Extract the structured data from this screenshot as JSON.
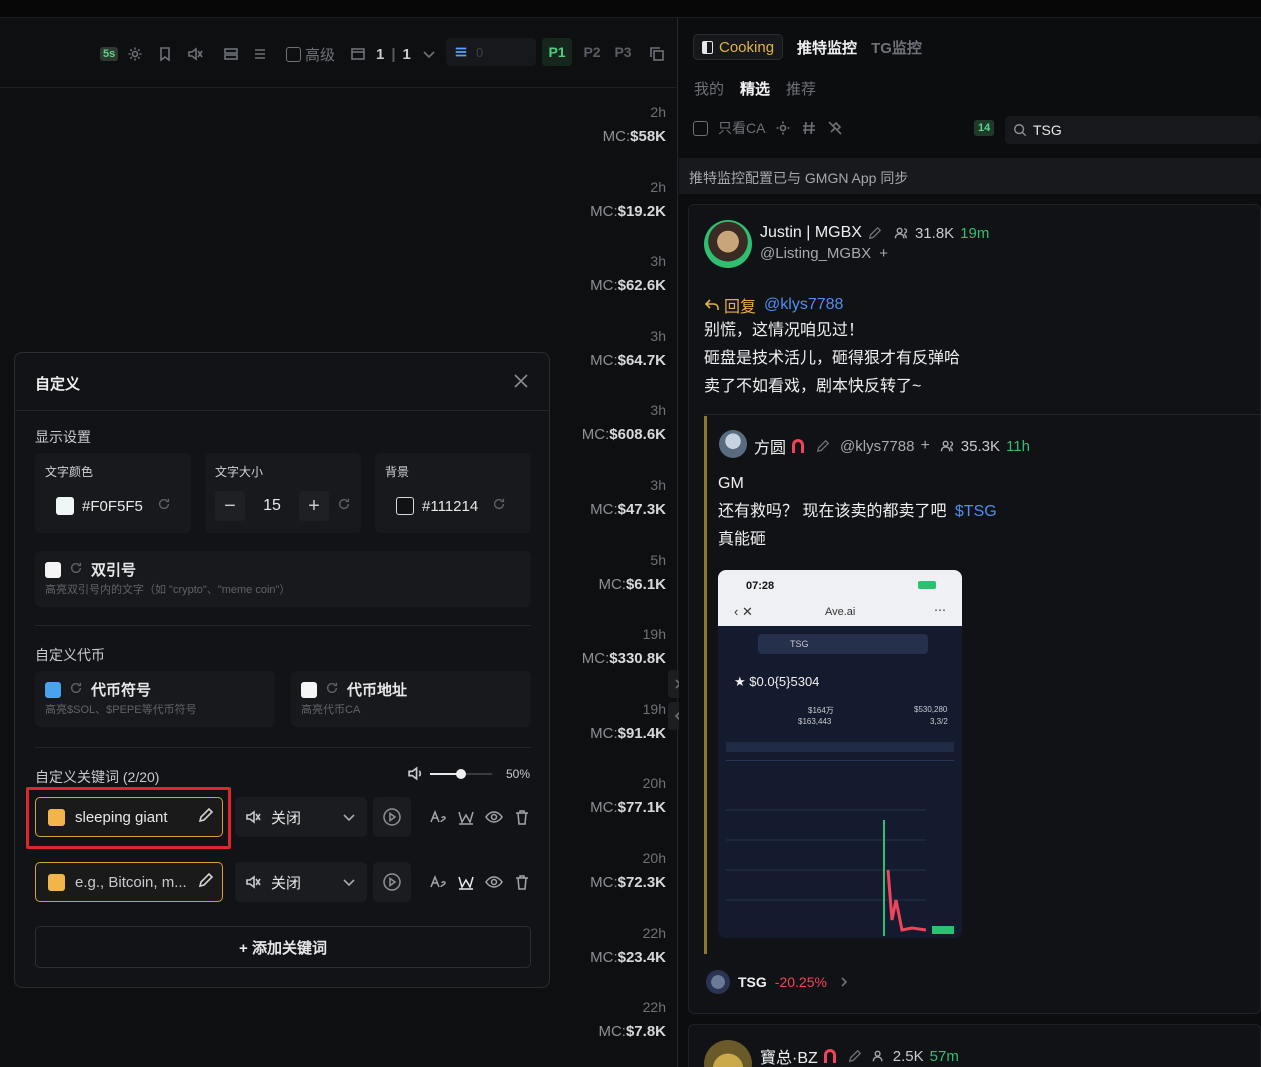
{
  "colors": {
    "accent_gold": "#e3b341",
    "link_blue": "#4d8ff0",
    "green": "#2fbf71",
    "red": "#f0445b",
    "highlight_red": "#e0262b"
  },
  "toolbar": {
    "badge_label": "5s",
    "checkbox_label": "高级",
    "page_counter_a": "1",
    "page_counter_b": "1",
    "input_placeholder": "0",
    "page_buttons": [
      "P1",
      "P2",
      "P3"
    ]
  },
  "feed_rows": [
    {
      "time": "2h",
      "mc_prefix": "MC:",
      "mc": "$58K"
    },
    {
      "time": "2h",
      "mc_prefix": "MC:",
      "mc": "$19.2K"
    },
    {
      "time": "3h",
      "mc_prefix": "MC:",
      "mc": "$62.6K"
    },
    {
      "time": "3h",
      "mc_prefix": "MC:",
      "mc": "$64.7K"
    },
    {
      "time": "3h",
      "mc_prefix": "MC:",
      "mc": "$608.6K"
    },
    {
      "time": "3h",
      "mc_prefix": "MC:",
      "mc": "$47.3K"
    },
    {
      "time": "5h",
      "mc_prefix": "MC:",
      "mc": "$6.1K"
    },
    {
      "time": "19h",
      "mc_prefix": "MC:",
      "mc": "$330.8K"
    },
    {
      "time": "19h",
      "mc_prefix": "MC:",
      "mc": "$91.4K"
    },
    {
      "time": "20h",
      "mc_prefix": "MC:",
      "mc": "$77.1K"
    },
    {
      "time": "20h",
      "mc_prefix": "MC:",
      "mc": "$72.3K"
    },
    {
      "time": "22h",
      "mc_prefix": "MC:",
      "mc": "$23.4K"
    },
    {
      "time": "22h",
      "mc_prefix": "MC:",
      "mc": "$7.8K"
    }
  ],
  "modal": {
    "title": "自定义",
    "display_section": "显示设置",
    "text_color_label": "文字颜色",
    "text_color_value": "#F0F5F5",
    "text_size_label": "文字大小",
    "text_size_value": "15",
    "bg_label": "背景",
    "bg_value": "#111214",
    "quote_label": "双引号",
    "quote_desc": "高亮双引号内的文字（如 \"crypto\"、\"meme coin\"）",
    "token_section": "自定义代币",
    "symbol_label": "代币符号",
    "symbol_desc": "高亮$SOL、$PEPE等代币符号",
    "address_label": "代币地址",
    "address_desc": "高亮代币CA",
    "keyword_section": "自定义关键词 (2/20)",
    "volume": "50%",
    "keywords": [
      {
        "value": "sleeping giant",
        "sound": "关闭"
      },
      {
        "value": "",
        "placeholder": "e.g., Bitcoin, m...",
        "sound": "关闭"
      }
    ],
    "add_keyword": "+ 添加关键词"
  },
  "right": {
    "tab_active": "Cooking",
    "tab_twitter": "推特监控",
    "tab_tg": "TG监控",
    "subtabs": [
      "我的",
      "精选",
      "推荐"
    ],
    "filter_only_ca": "只看CA",
    "filter_badge": "14",
    "search_value": "TSG",
    "sync_notice": "推特监控配置已与 GMGN App 同步",
    "tweet": {
      "author": "Justin | MGBX",
      "followers": "31.8K",
      "age": "19m",
      "handle": "@Listing_MGBX",
      "reply_label": "回复",
      "reply_to": "@klys7788",
      "lines": [
        "别慌，这情况咱见过！",
        "砸盘是技术活儿，砸得狠才有反弹哈",
        "卖了不如看戏，剧本快反转了~"
      ]
    },
    "quoted": {
      "author": "方圆",
      "handle": "@klys7788",
      "followers": "35.3K",
      "age": "11h",
      "lines": [
        "GM",
        "还有救吗？ 现在该卖的都卖了吧",
        "真能砸"
      ],
      "ticker": "$TSG"
    },
    "phone": {
      "time": "07:28",
      "site": "Ave.ai",
      "token": "TSG",
      "price": "$0.0{5}5304",
      "stat_a": "$164万",
      "stat_b": "$530,280",
      "stat_c": "$163,443",
      "stat_d": "3,3/2"
    },
    "token_chip": {
      "symbol": "TSG",
      "change": "-20.25%"
    },
    "next_tweet": {
      "author": "寶总·BZ",
      "followers": "2.5K",
      "age": "57m"
    }
  }
}
